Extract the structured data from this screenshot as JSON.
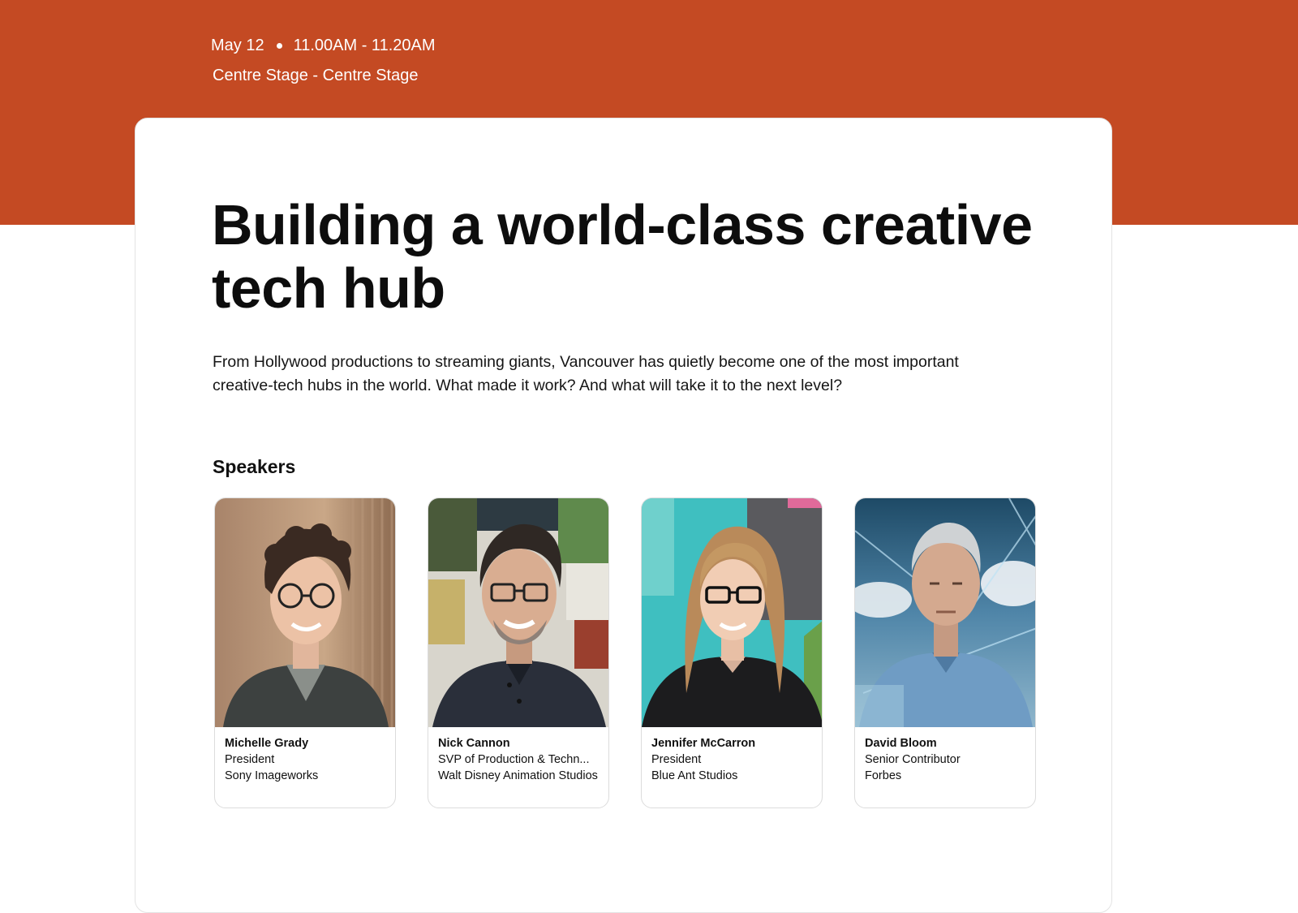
{
  "event": {
    "date": "May 12",
    "time": "11.00AM - 11.20AM",
    "location": "Centre Stage - Centre Stage",
    "accent_color": "#C44A23"
  },
  "session": {
    "title": "Building a world-class creative tech hub",
    "description": "From Hollywood productions to streaming giants, Vancouver has quietly become one of the most important creative-tech hubs in the world. What made it work? And what will take it to the next level?"
  },
  "speakers": {
    "heading": "Speakers",
    "items": [
      {
        "name": "Michelle Grady",
        "role": "President",
        "company": "Sony Imageworks"
      },
      {
        "name": "Nick Cannon",
        "role": "SVP of Production & Techn...",
        "company": "Walt Disney Animation Studios"
      },
      {
        "name": "Jennifer McCarron",
        "role": "President",
        "company": "Blue Ant Studios"
      },
      {
        "name": "David Bloom",
        "role": "Senior Contributor",
        "company": "Forbes"
      }
    ]
  }
}
